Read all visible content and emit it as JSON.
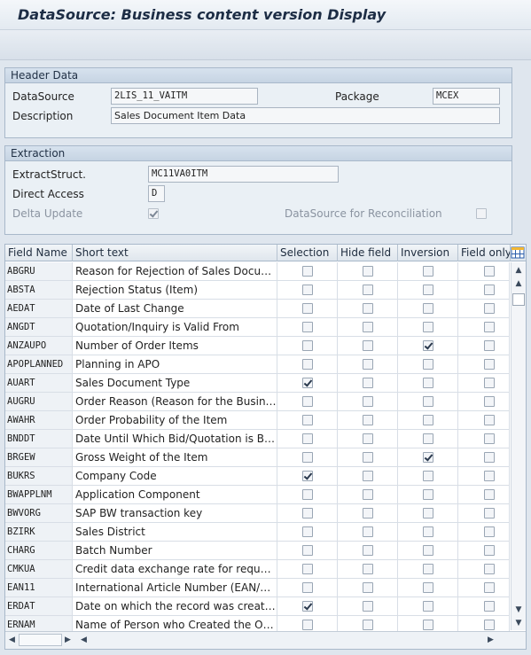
{
  "window": {
    "title": "DataSource: Business content version Display"
  },
  "header_data": {
    "group_title": "Header Data",
    "datasource_label": "DataSource",
    "datasource_value": "2LIS_11_VAITM",
    "package_label": "Package",
    "package_value": "MCEX",
    "description_label": "Description",
    "description_value": "Sales Document Item Data"
  },
  "extraction": {
    "group_title": "Extraction",
    "extractstruct_label": "ExtractStruct.",
    "extractstruct_value": "MC11VA0ITM",
    "direct_access_label": "Direct Access",
    "direct_access_value": "D",
    "delta_update_label": "Delta Update",
    "delta_update_checked": true,
    "reconciliation_label": "DataSource for Reconciliation",
    "reconciliation_checked": false
  },
  "table": {
    "columns": [
      "Field Name",
      "Short text",
      "Selection",
      "Hide field",
      "Inversion",
      "Field only..."
    ],
    "rows": [
      {
        "field": "ABGRU",
        "text": "Reason for Rejection of Sales Documents",
        "selection": false,
        "hide": false,
        "inversion": false,
        "field_only": false
      },
      {
        "field": "ABSTA",
        "text": "Rejection Status (Item)",
        "selection": false,
        "hide": false,
        "inversion": false,
        "field_only": false
      },
      {
        "field": "AEDAT",
        "text": "Date of Last Change",
        "selection": false,
        "hide": false,
        "inversion": false,
        "field_only": false
      },
      {
        "field": "ANGDT",
        "text": "Quotation/Inquiry is Valid From",
        "selection": false,
        "hide": false,
        "inversion": false,
        "field_only": false
      },
      {
        "field": "ANZAUPO",
        "text": "Number of Order Items",
        "selection": false,
        "hide": false,
        "inversion": true,
        "field_only": false
      },
      {
        "field": "APOPLANNED",
        "text": "Planning in APO",
        "selection": false,
        "hide": false,
        "inversion": false,
        "field_only": false
      },
      {
        "field": "AUART",
        "text": "Sales Document Type",
        "selection": true,
        "hide": false,
        "inversion": false,
        "field_only": false
      },
      {
        "field": "AUGRU",
        "text": "Order Reason (Reason for the Business ...",
        "selection": false,
        "hide": false,
        "inversion": false,
        "field_only": false
      },
      {
        "field": "AWAHR",
        "text": "Order Probability of the Item",
        "selection": false,
        "hide": false,
        "inversion": false,
        "field_only": false
      },
      {
        "field": "BNDDT",
        "text": "Date Until Which Bid/Quotation is Bindin...",
        "selection": false,
        "hide": false,
        "inversion": false,
        "field_only": false
      },
      {
        "field": "BRGEW",
        "text": "Gross Weight of the Item",
        "selection": false,
        "hide": false,
        "inversion": true,
        "field_only": false
      },
      {
        "field": "BUKRS",
        "text": "Company Code",
        "selection": true,
        "hide": false,
        "inversion": false,
        "field_only": false
      },
      {
        "field": "BWAPPLNM",
        "text": "Application Component",
        "selection": false,
        "hide": false,
        "inversion": false,
        "field_only": false
      },
      {
        "field": "BWVORG",
        "text": "SAP BW transaction key",
        "selection": false,
        "hide": false,
        "inversion": false,
        "field_only": false
      },
      {
        "field": "BZIRK",
        "text": "Sales District",
        "selection": false,
        "hide": false,
        "inversion": false,
        "field_only": false
      },
      {
        "field": "CHARG",
        "text": "Batch Number",
        "selection": false,
        "hide": false,
        "inversion": false,
        "field_only": false
      },
      {
        "field": "CMKUA",
        "text": "Credit data exchange rate for requested...",
        "selection": false,
        "hide": false,
        "inversion": false,
        "field_only": false
      },
      {
        "field": "EAN11",
        "text": "International Article Number (EAN/UPC)",
        "selection": false,
        "hide": false,
        "inversion": false,
        "field_only": false
      },
      {
        "field": "ERDAT",
        "text": "Date on which the record was created",
        "selection": true,
        "hide": false,
        "inversion": false,
        "field_only": false
      },
      {
        "field": "ERNAM",
        "text": "Name of Person who Created the Object",
        "selection": false,
        "hide": false,
        "inversion": false,
        "field_only": false
      }
    ]
  },
  "icons": {
    "column_config": "table-settings-icon",
    "scroll_up": "scroll-up-icon",
    "scroll_down": "scroll-down-icon",
    "scroll_left": "scroll-left-icon",
    "scroll_right": "scroll-right-icon"
  }
}
